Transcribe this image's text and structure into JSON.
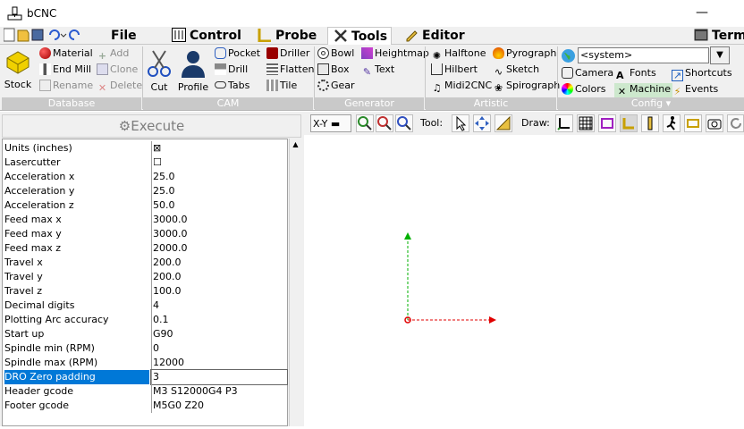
{
  "window": {
    "title": "bCNC",
    "minimize": "—"
  },
  "tabs": [
    {
      "label": "File"
    },
    {
      "label": "Control"
    },
    {
      "label": "Probe"
    },
    {
      "label": "Tools"
    },
    {
      "label": "Editor"
    },
    {
      "label": "Term"
    }
  ],
  "ribbon": {
    "database": {
      "group": "Database",
      "stock": "Stock",
      "material": "Material",
      "endmill": "End Mill",
      "rename": "Rename",
      "add": "Add",
      "clone": "Clone",
      "delete": "Delete"
    },
    "cam": {
      "group": "CAM",
      "cut": "Cut",
      "profile": "Profile",
      "pocket": "Pocket",
      "drill": "Drill",
      "tabs": "Tabs",
      "driller": "Driller",
      "flatten": "Flatten",
      "tile": "Tile"
    },
    "generator": {
      "group": "Generator",
      "bowl": "Bowl",
      "box": "Box",
      "gear": "Gear",
      "heightmap": "Heightmap",
      "text": "Text"
    },
    "artistic": {
      "group": "Artistic",
      "halftone": "Halftone",
      "hilbert": "Hilbert",
      "midi2cnc": "Midi2CNC",
      "pyrograph": "Pyrograph",
      "sketch": "Sketch",
      "spirograph": "Spirograph"
    },
    "config": {
      "group": "Config",
      "system_value": "<system>",
      "camera": "Camera",
      "fonts": "Fonts",
      "shortcuts": "Shortcuts",
      "colors": "Colors",
      "machine": "Machine",
      "events": "Events"
    }
  },
  "execute_label": "Execute",
  "properties": [
    {
      "key": "Units (inches)",
      "value": "⊠"
    },
    {
      "key": "Lasercutter",
      "value": "☐"
    },
    {
      "key": "Acceleration x",
      "value": "25.0"
    },
    {
      "key": "Acceleration y",
      "value": "25.0"
    },
    {
      "key": "Acceleration z",
      "value": "50.0"
    },
    {
      "key": "Feed max x",
      "value": "3000.0"
    },
    {
      "key": "Feed max y",
      "value": "3000.0"
    },
    {
      "key": "Feed max z",
      "value": "2000.0"
    },
    {
      "key": "Travel x",
      "value": "200.0"
    },
    {
      "key": "Travel y",
      "value": "200.0"
    },
    {
      "key": "Travel z",
      "value": "100.0"
    },
    {
      "key": "Decimal digits",
      "value": "4"
    },
    {
      "key": "Plotting Arc accuracy",
      "value": "0.1"
    },
    {
      "key": "Start up",
      "value": "G90"
    },
    {
      "key": "Spindle min (RPM)",
      "value": "0"
    },
    {
      "key": "Spindle max (RPM)",
      "value": "12000"
    },
    {
      "key": "DRO Zero padding",
      "value": "3"
    },
    {
      "key": "Header gcode",
      "value": "M3 S12000G4 P3"
    },
    {
      "key": "Footer gcode",
      "value": "M5G0 Z20"
    }
  ],
  "canvas_toolbar": {
    "view": "X-Y",
    "tool_label": "Tool:",
    "draw_label": "Draw:"
  },
  "colors": {
    "selection": "#0078d7",
    "axis_x": "#e00000",
    "axis_y": "#00b000"
  }
}
